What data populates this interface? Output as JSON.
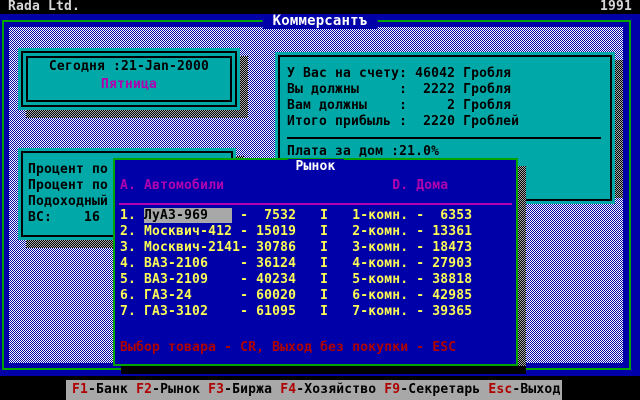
{
  "palette": {
    "background_blue": "#0000A8",
    "teal_panel": "#00A8A8",
    "green_border": "#00A400",
    "magenta": "#B000B0",
    "yellow": "#FCFC54",
    "red": "#B00000",
    "gray": "#A8A8A8"
  },
  "titlebar": {
    "left": "Rada Ltd.",
    "right": "1991"
  },
  "app_title": "Коммерсантъ",
  "date_box": {
    "today": "Сегодня :21-Jan-2000",
    "weekday": "Пятница"
  },
  "taxes_box": {
    "rows": [
      "Процент по",
      "Процент по",
      "Подоходный",
      "ВС:    16"
    ]
  },
  "account_box": {
    "rows": [
      "У Вас на счету: 46042 Гробля",
      "Вы должны     :  2222 Гробля",
      "Вам должны    :     2 Гробля",
      "Итого прибыль :  2220 Гроблей"
    ],
    "house_payment": "Плата за дом :21.0%"
  },
  "market": {
    "title": "Рынок",
    "header": "А. Автомобили                     D. Дома",
    "selected_row": {
      "num": "1. ",
      "name": "ЛуАЗ-969   ",
      "rest": " -  7532   I   1-комн. -  6353"
    },
    "rows": [
      "2. Москвич-412 - 15019   I   2-комн. - 13361",
      "3. Москвич-2141- 30786   I   3-комн. - 18473",
      "4. ВАЗ-2106    - 36124   I   4-комн. - 27903",
      "5. ВАЗ-2109    - 40234   I   5-комн. - 38818",
      "6. ГАЗ-24      - 60020   I   6-комн. - 42985",
      "7. ГАЗ-3102    - 61095   I   7-комн. - 39365"
    ],
    "footer": "Выбор товара - CR, Выход без покупки - ESC"
  },
  "fkeys": [
    {
      "key": "F1",
      "label": "-Банк"
    },
    {
      "key": "F2",
      "label": "-Рынок"
    },
    {
      "key": "F3",
      "label": "-Биржа"
    },
    {
      "key": "F4",
      "label": "-Хозяйство"
    },
    {
      "key": "F9",
      "label": "-Секретарь"
    },
    {
      "key": "Esc",
      "label": "-Выход"
    }
  ]
}
